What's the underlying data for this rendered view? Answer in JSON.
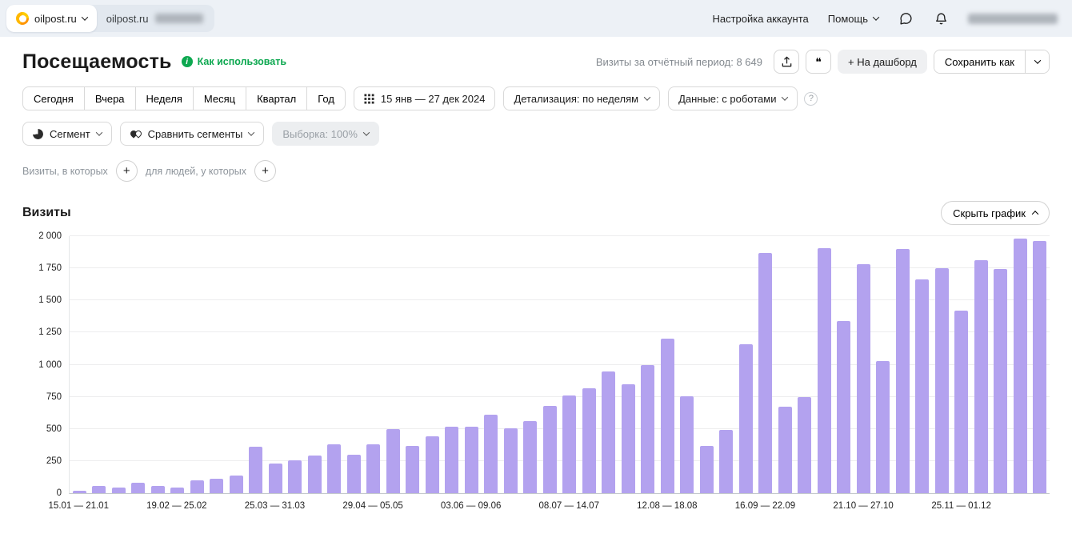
{
  "colors": {
    "accent_green": "#0da850",
    "bar_color": "#b3a2ef",
    "topbar_bg": "#edf1f6"
  },
  "icons": {
    "info_glyph": "i",
    "notes_glyph": "❝",
    "question_glyph": "?",
    "plus_glyph": "+"
  },
  "topbar": {
    "counter_name": "oilpost.ru",
    "counter_domain": "oilpost.ru",
    "account_settings": "Настройка аккаунта",
    "help": "Помощь"
  },
  "header": {
    "title": "Посещаемость",
    "how_to_use": "Как использовать",
    "visits_period_label": "Визиты за отчётный период:",
    "visits_period_value": "8 649",
    "dashboard_button": "+ На дашборд",
    "save_as_button": "Сохранить как"
  },
  "filters": {
    "period_presets": [
      "Сегодня",
      "Вчера",
      "Неделя",
      "Месяц",
      "Квартал",
      "Год"
    ],
    "date_range": "15 янв — 27 дек 2024",
    "detalization": "Детализация: по неделям",
    "data_mode": "Данные: с роботами",
    "segment": "Сегмент",
    "compare_segments": "Сравнить сегменты",
    "sampling": "Выборка: 100%",
    "visits_condition_label": "Визиты, в которых",
    "people_condition_label": "для людей, у которых"
  },
  "chart_section": {
    "title": "Визиты",
    "hide_chart_button": "Скрыть график"
  },
  "chart_data": {
    "type": "bar",
    "title": "Визиты",
    "xlabel": "",
    "ylabel": "",
    "ylim": [
      0,
      2000
    ],
    "grid": true,
    "legend": false,
    "y_ticks": [
      "0",
      "250",
      "500",
      "750",
      "1 000",
      "1 250",
      "1 500",
      "1 750",
      "2 000"
    ],
    "categories": [
      "15.01",
      "22.01",
      "29.01",
      "05.02",
      "12.02",
      "19.02",
      "26.02",
      "04.03",
      "11.03",
      "18.03",
      "25.03",
      "01.04",
      "08.04",
      "15.04",
      "22.04",
      "29.04",
      "06.05",
      "13.05",
      "20.05",
      "27.05",
      "03.06",
      "10.06",
      "17.06",
      "24.06",
      "01.07",
      "08.07",
      "15.07",
      "22.07",
      "29.07",
      "05.08",
      "12.08",
      "19.08",
      "26.08",
      "02.09",
      "09.09",
      "16.09",
      "23.09",
      "30.09",
      "07.10",
      "14.10",
      "21.10",
      "28.10",
      "04.11",
      "11.11",
      "18.11",
      "25.11",
      "02.12",
      "09.12",
      "16.12",
      "23.12"
    ],
    "values": [
      20,
      55,
      45,
      80,
      55,
      45,
      100,
      115,
      140,
      360,
      230,
      255,
      290,
      380,
      300,
      380,
      500,
      365,
      445,
      515,
      520,
      610,
      505,
      560,
      680,
      760,
      815,
      950,
      850,
      1000,
      1200,
      755,
      370,
      490,
      1160,
      1870,
      670,
      745,
      1905,
      1340,
      1780,
      1030,
      1900,
      1665,
      1750,
      1420,
      1815,
      1745,
      1980,
      1960
    ],
    "x_tick_labels": [
      {
        "index": 0,
        "label": "15.01 — 21.01"
      },
      {
        "index": 5,
        "label": "19.02 — 25.02"
      },
      {
        "index": 10,
        "label": "25.03 — 31.03"
      },
      {
        "index": 15,
        "label": "29.04 — 05.05"
      },
      {
        "index": 20,
        "label": "03.06 — 09.06"
      },
      {
        "index": 25,
        "label": "08.07 — 14.07"
      },
      {
        "index": 30,
        "label": "12.08 — 18.08"
      },
      {
        "index": 35,
        "label": "16.09 — 22.09"
      },
      {
        "index": 40,
        "label": "21.10 — 27.10"
      },
      {
        "index": 45,
        "label": "25.11 — 01.12"
      }
    ]
  }
}
